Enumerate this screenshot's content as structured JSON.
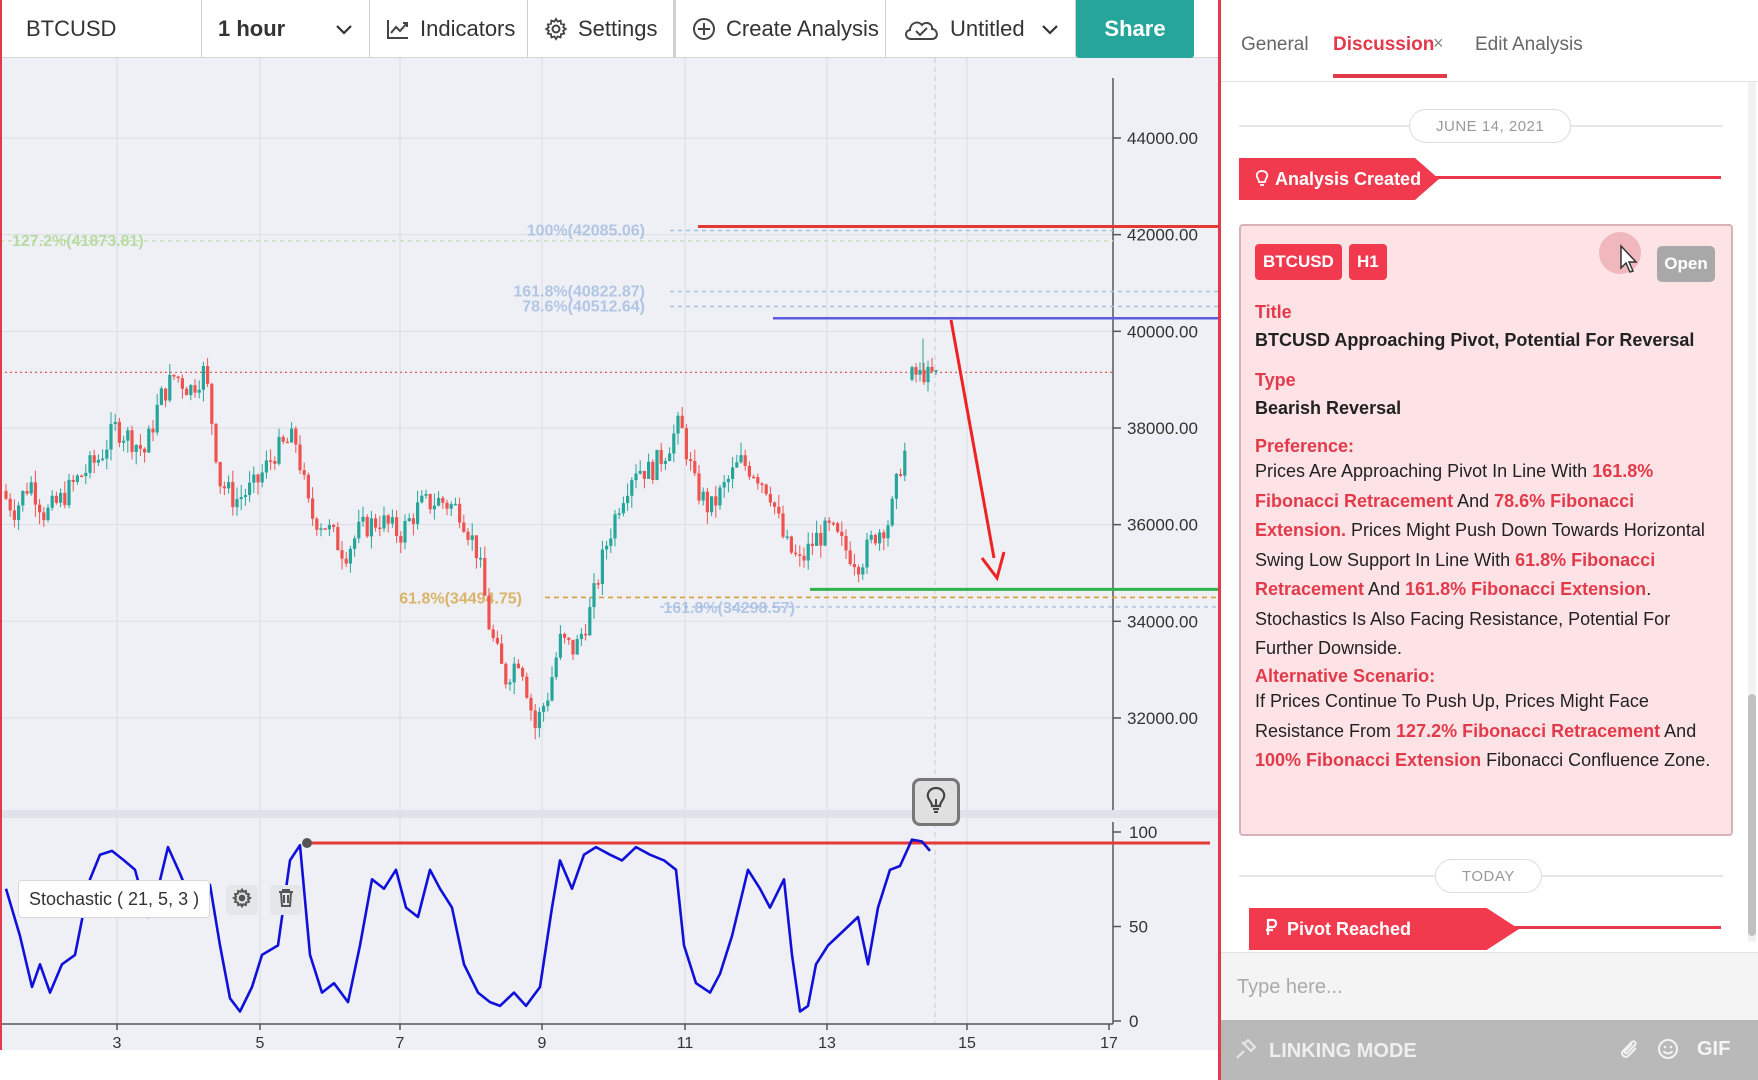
{
  "toolbar": {
    "symbol": "BTCUSD",
    "timeframe": "1 hour",
    "indicators_label": "Indicators",
    "settings_label": "Settings",
    "create_label": "Create Analysis",
    "untitled_label": "Untitled",
    "share_label": "Share"
  },
  "chart": {
    "price_axis": [
      "44000.00",
      "42000.00",
      "40000.00",
      "38000.00",
      "36000.00",
      "34000.00",
      "32000.00"
    ],
    "fib_labels": {
      "ext_127": "127.2%(41873.81)",
      "ret_100": "100%(42085.06)",
      "ret_1618": "161.8%(40822.87)",
      "ret_786": "78.6%(40512.64)",
      "ret_618": "61.8%(34494.75)",
      "ext_1618_low": "161.8%(34298.57)"
    },
    "stochastic_label": "Stochastic ( 21, 5, 3 )",
    "stoch_axis": [
      "100",
      "50",
      "0"
    ],
    "x_axis": [
      "3",
      "5",
      "7",
      "9",
      "11",
      "13",
      "15",
      "17"
    ],
    "colors": {
      "bull": "#26a69a",
      "bear": "#ef5350",
      "resistance": "#e53935",
      "pivot": "#5c5ce0",
      "support": "#2fb24c",
      "fib_gold": "#d4a13a",
      "fib_blue": "#9db9df",
      "stoch": "#1010d8"
    }
  },
  "panel": {
    "tabs": {
      "general": "General",
      "discussion": "Discussion",
      "close": "×",
      "edit": "Edit Analysis"
    },
    "date_top": "JUNE 14, 2021",
    "event_created": "Analysis Created",
    "card": {
      "symbol_badge": "BTCUSD",
      "tf_badge": "H1",
      "open_label": "Open",
      "title_label": "Title",
      "title_value": "BTCUSD Approaching Pivot, Potential For Reversal",
      "type_label": "Type",
      "type_value": "Bearish Reversal",
      "pref_label": "Preference:",
      "pref_parts": [
        {
          "t": "Prices Are Approaching Pivot In Line With ",
          "h": false
        },
        {
          "t": "161.8% Fibonacci Retracement",
          "h": true
        },
        {
          "t": " And ",
          "h": false
        },
        {
          "t": "78.6% Fibonacci Extension.",
          "h": true
        },
        {
          "t": " Prices Might Push Down Towards Horizontal Swing Low Support In Line With ",
          "h": false
        },
        {
          "t": "61.8% Fibonacci Retracement",
          "h": true
        },
        {
          "t": " And ",
          "h": false
        },
        {
          "t": "161.8% Fibonacci Extension",
          "h": true
        },
        {
          "t": ". Stochastics Is Also Facing Resistance, Potential For Further Downside.",
          "h": false
        }
      ],
      "alt_label": "Alternative Scenario:",
      "alt_parts": [
        {
          "t": "If Prices Continue To Push Up, Prices Might Face Resistance From ",
          "h": false
        },
        {
          "t": "127.2% Fibonacci Retracement",
          "h": true
        },
        {
          "t": " And ",
          "h": false
        },
        {
          "t": "100% Fibonacci Extension",
          "h": true
        },
        {
          "t": " Fibonacci Confluence Zone.",
          "h": false
        }
      ]
    },
    "date_today": "TODAY",
    "event_pivot": "Pivot Reached",
    "input_placeholder": "Type here...",
    "linking_mode": "LINKING MODE",
    "gif_label": "GIF"
  }
}
